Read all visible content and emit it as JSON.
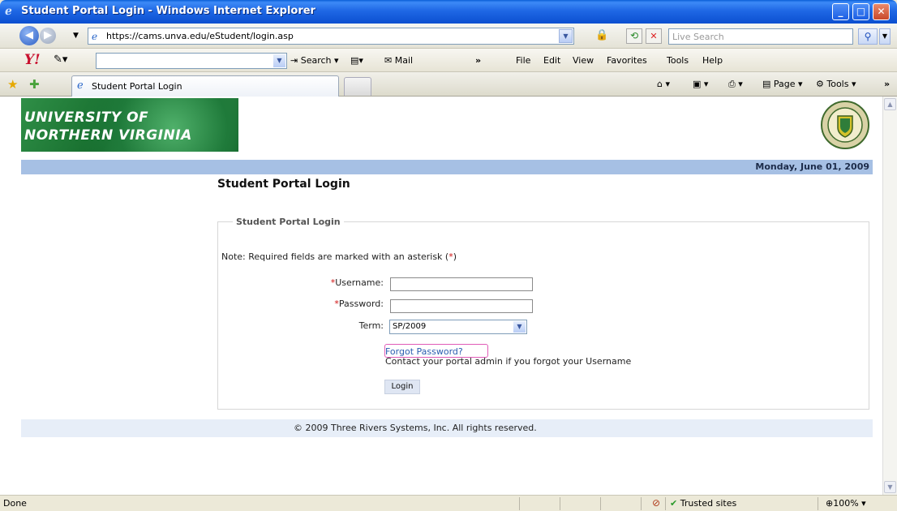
{
  "window": {
    "title": "Student Portal Login - Windows Internet Explorer",
    "minimize": "_",
    "maximize": "□",
    "close": "✕"
  },
  "address_bar": {
    "url": "https://cams.unva.edu/eStudent/login.asp",
    "search_placeholder": "Live Search"
  },
  "toolbar": {
    "search_label": "Search",
    "mail_label": "Mail",
    "chevron": "»",
    "menus": [
      "File",
      "Edit",
      "View",
      "Favorites",
      "Tools",
      "Help"
    ]
  },
  "tabs": {
    "active_tab_label": "Student Portal Login",
    "commands": [
      "Page",
      "Tools"
    ]
  },
  "page": {
    "banner_line1": "UNIVERSITY OF",
    "banner_line2": "NORTHERN VIRGINIA",
    "date": "Monday, June 01, 2009",
    "title": "Student Portal Login",
    "form": {
      "legend": "Student Portal Login",
      "note_prefix": "Note: Required fields are marked with an asterisk (",
      "note_asterisk": "*",
      "note_suffix": ")",
      "username_label": "Username:",
      "password_label": "Password:",
      "term_label": "Term:",
      "term_value": "SP/2009",
      "forgot_password": "Forgot Password?",
      "contact_text": "Contact your portal admin if you forgot your Username",
      "login_button": "Login"
    },
    "footer": "© 2009 Three Rivers Systems, Inc. All rights reserved."
  },
  "status_bar": {
    "status": "Done",
    "zone": "Trusted sites",
    "zoom": "100%"
  },
  "icons": {
    "ie_logo": "ie-logo-icon",
    "back": "back-arrow-icon",
    "forward": "forward-arrow-icon",
    "lock": "lock-icon",
    "refresh": "refresh-icon",
    "stop": "stop-icon",
    "search": "search-icon",
    "yahoo": "yahoo-icon",
    "favorites_star": "favorites-star-icon",
    "add_favorite": "add-favorite-icon",
    "home": "home-icon",
    "feeds": "feeds-icon",
    "print": "print-icon",
    "seal": "university-seal-icon"
  },
  "colors": {
    "title_bar": "#1f68e5",
    "date_bar": "#a6c0e4",
    "link": "#2a5db0",
    "required": "#d01010",
    "banner_green": "#1f7a3a"
  }
}
